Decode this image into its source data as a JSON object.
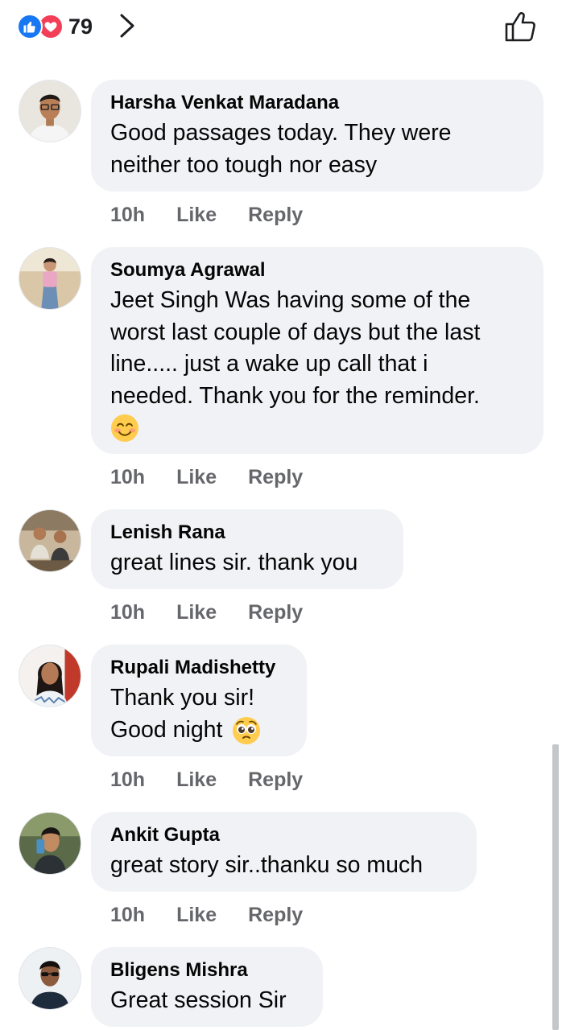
{
  "header": {
    "reaction_count": "79",
    "icons": [
      "like-reaction",
      "love-reaction",
      "chevron-right",
      "thumbs-up-outline"
    ],
    "colors": {
      "like": "#1877f2",
      "love": "#f33e58"
    }
  },
  "comments": [
    {
      "author": "Harsha Venkat Maradana",
      "lines": [
        "Good passages today. They were",
        "neither too tough nor easy"
      ],
      "time": "10h",
      "like": "Like",
      "reply": "Reply"
    },
    {
      "author": "Soumya Agrawal",
      "lines": [
        "Jeet Singh Was having some of the",
        "worst last couple of days but the last",
        "line..... just a wake up call that i",
        "needed. Thank you for the reminder."
      ],
      "emoji": "smiling-face-with-smiling-eyes",
      "time": "10h",
      "like": "Like",
      "reply": "Reply"
    },
    {
      "author": "Lenish Rana",
      "lines": [
        "great lines sir. thank you"
      ],
      "time": "10h",
      "like": "Like",
      "reply": "Reply"
    },
    {
      "author": "Rupali Madishetty",
      "lines": [
        "Thank you sir!",
        "Good night"
      ],
      "emoji": "pleading-face",
      "time": "10h",
      "like": "Like",
      "reply": "Reply"
    },
    {
      "author": "Ankit Gupta",
      "lines": [
        "great story sir..thanku so much"
      ],
      "time": "10h",
      "like": "Like",
      "reply": "Reply"
    },
    {
      "author": "Bligens Mishra",
      "lines": [
        "Great session Sir"
      ],
      "time": "10h",
      "like": "Like",
      "reply": "Reply"
    }
  ]
}
